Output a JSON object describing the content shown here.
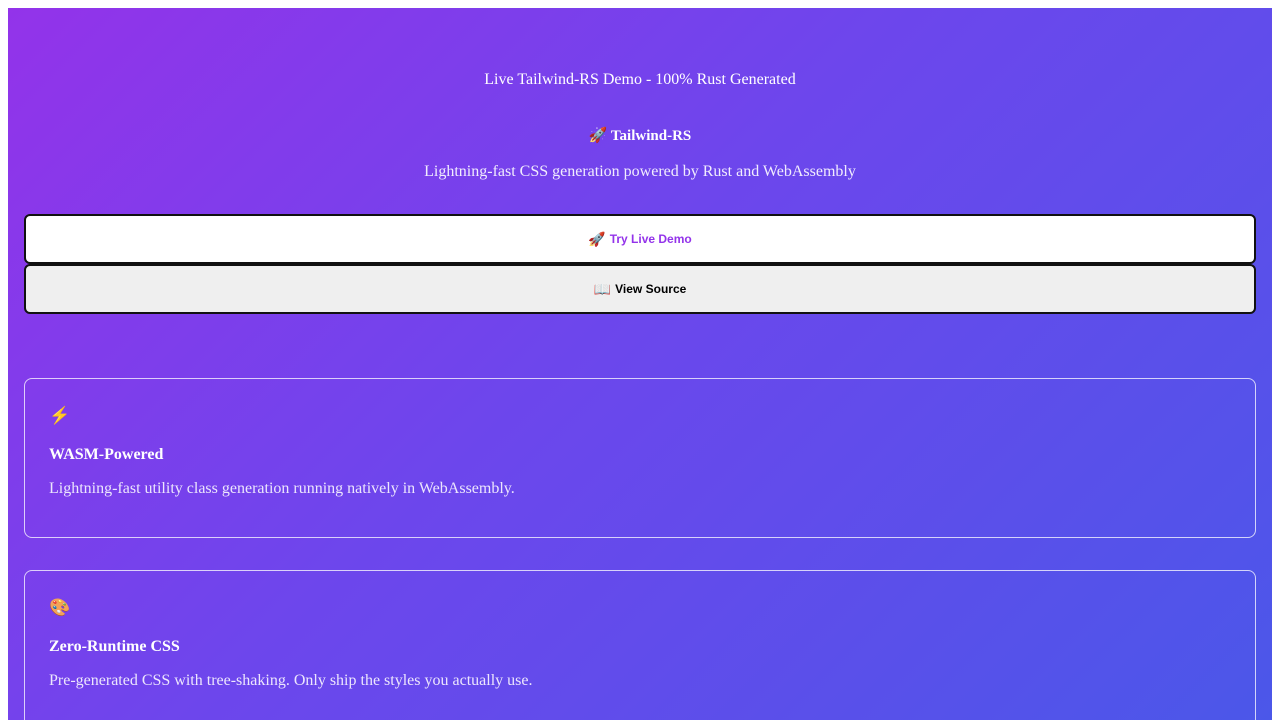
{
  "hero": {
    "tagline": "Live Tailwind-RS Demo - 100% Rust Generated",
    "brand_icon": "rocket-icon",
    "brand_glyph": "🚀",
    "brand": "Tailwind-RS",
    "subtitle": "Lightning-fast CSS generation powered by Rust and WebAssembly"
  },
  "actions": {
    "primary": {
      "icon": "rocket-icon",
      "glyph": "🚀",
      "label": "Try Live Demo"
    },
    "secondary": {
      "icon": "book-icon",
      "glyph": "📖",
      "label": "View Source"
    }
  },
  "features": [
    {
      "icon": "lightning-icon",
      "glyph": "⚡",
      "title": "WASM-Powered",
      "description": "Lightning-fast utility class generation running natively in WebAssembly."
    },
    {
      "icon": "palette-icon",
      "glyph": "🎨",
      "title": "Zero-Runtime CSS",
      "description": "Pre-generated CSS with tree-shaking. Only ship the styles you actually use."
    }
  ],
  "colors": {
    "gradient_start": "#9333ea",
    "gradient_end": "#4b57e9",
    "primary_text": "#9333ea"
  }
}
